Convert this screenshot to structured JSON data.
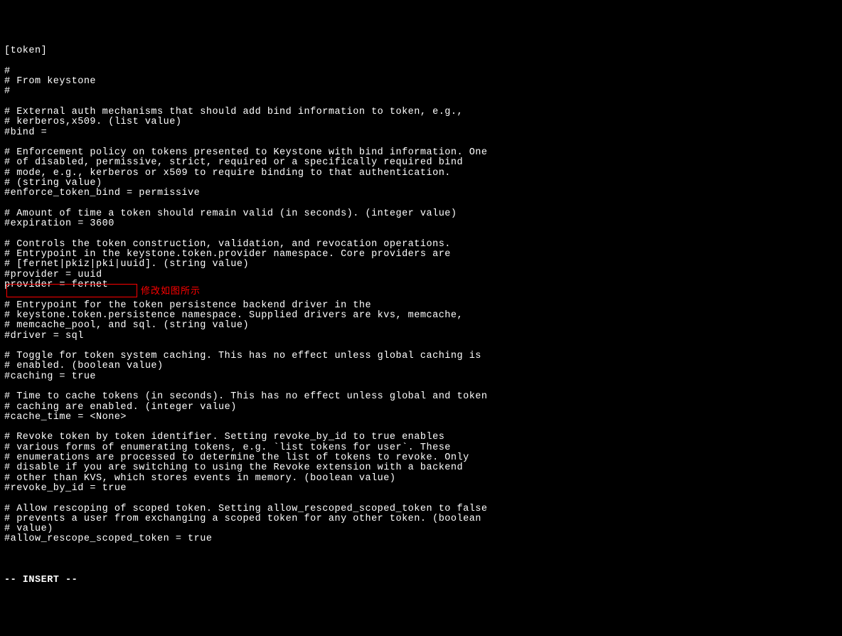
{
  "config": {
    "lines": [
      "[token]",
      "",
      "#",
      "# From keystone",
      "#",
      "",
      "# External auth mechanisms that should add bind information to token, e.g.,",
      "# kerberos,x509. (list value)",
      "#bind =",
      "",
      "# Enforcement policy on tokens presented to Keystone with bind information. One",
      "# of disabled, permissive, strict, required or a specifically required bind",
      "# mode, e.g., kerberos or x509 to require binding to that authentication.",
      "# (string value)",
      "#enforce_token_bind = permissive",
      "",
      "# Amount of time a token should remain valid (in seconds). (integer value)",
      "#expiration = 3600",
      "",
      "# Controls the token construction, validation, and revocation operations.",
      "# Entrypoint in the keystone.token.provider namespace. Core providers are",
      "# [fernet|pkiz|pki|uuid]. (string value)",
      "#provider = uuid",
      "provider = fernet",
      "",
      "# Entrypoint for the token persistence backend driver in the",
      "# keystone.token.persistence namespace. Supplied drivers are kvs, memcache,",
      "# memcache_pool, and sql. (string value)",
      "#driver = sql",
      "",
      "# Toggle for token system caching. This has no effect unless global caching is",
      "# enabled. (boolean value)",
      "#caching = true",
      "",
      "# Time to cache tokens (in seconds). This has no effect unless global and token",
      "# caching are enabled. (integer value)",
      "#cache_time = <None>",
      "",
      "# Revoke token by token identifier. Setting revoke_by_id to true enables",
      "# various forms of enumerating tokens, e.g. `list tokens for user`. These",
      "# enumerations are processed to determine the list of tokens to revoke. Only",
      "# disable if you are switching to using the Revoke extension with a backend",
      "# other than KVS, which stores events in memory. (boolean value)",
      "#revoke_by_id = true",
      "",
      "# Allow rescoping of scoped token. Setting allow_rescoped_scoped_token to false",
      "# prevents a user from exchanging a scoped token for any other token. (boolean",
      "# value)",
      "#allow_rescope_scoped_token = true",
      ""
    ]
  },
  "annotation_text": "修改如图所示",
  "status_mode": "-- INSERT --"
}
